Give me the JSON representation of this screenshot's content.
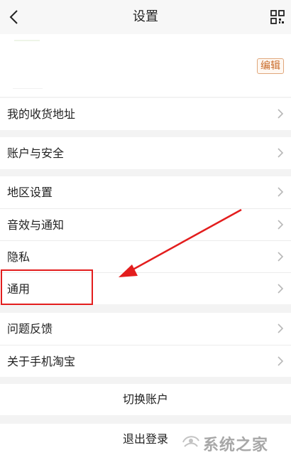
{
  "header": {
    "title": "设置",
    "back_icon": "back-arrow-icon",
    "right_icon": "qr-scan-icon"
  },
  "profile": {
    "edit_label": "编辑"
  },
  "groups": [
    {
      "items": [
        {
          "label": "我的收货地址",
          "icon": "chevron-right-icon"
        }
      ]
    },
    {
      "items": [
        {
          "label": "账户与安全",
          "icon": "chevron-right-icon"
        }
      ]
    },
    {
      "items": [
        {
          "label": "地区设置",
          "icon": "chevron-right-icon"
        },
        {
          "label": "音效与通知",
          "icon": "chevron-right-icon"
        },
        {
          "label": "隐私",
          "icon": "chevron-right-icon"
        },
        {
          "label": "通用",
          "icon": "chevron-right-icon"
        }
      ]
    },
    {
      "items": [
        {
          "label": "问题反馈",
          "icon": "chevron-right-icon"
        },
        {
          "label": "关于手机淘宝",
          "icon": "chevron-right-icon"
        }
      ]
    }
  ],
  "actions": {
    "switch_account": "切换账户",
    "logout": "退出登录"
  },
  "annotation": {
    "color": "#e31d1d",
    "highlight_target": "通用"
  },
  "watermark": {
    "text": "系统之家"
  },
  "colors": {
    "background": "#f3f3f3",
    "edit_accent": "#c96b2a",
    "annotation_red": "#e31d1d"
  }
}
